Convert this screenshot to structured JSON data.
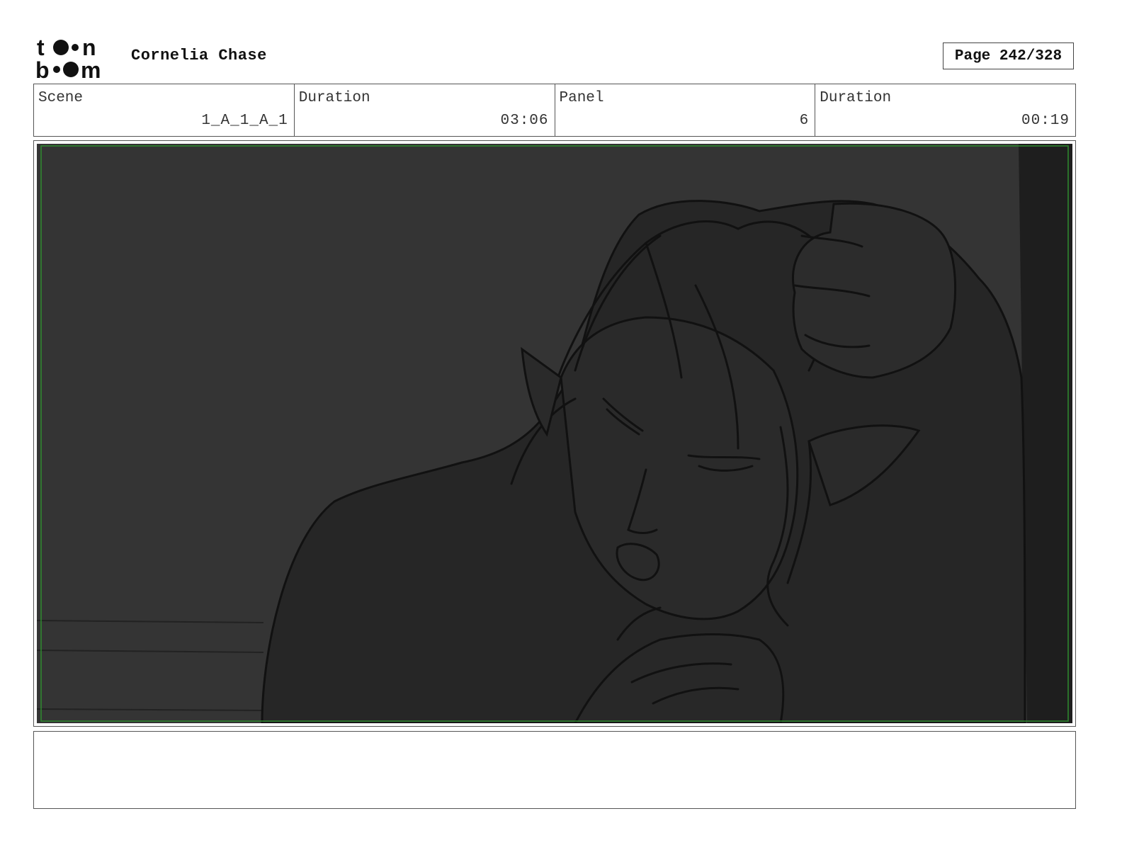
{
  "header": {
    "logo_text": "toon boom",
    "project_title": "Cornelia Chase",
    "page_label": "Page 242/328"
  },
  "info": {
    "scene_label": "Scene",
    "scene_value": "1_A_1_A_1",
    "scene_duration_label": "Duration",
    "scene_duration_value": "03:06",
    "panel_label": "Panel",
    "panel_value": "6",
    "panel_duration_label": "Duration",
    "panel_duration_value": "00:19"
  },
  "panel": {
    "safe_area_color": "#2e8b2e",
    "background_color": "#333333",
    "figure_color": "#262626"
  },
  "notes": {
    "text": ""
  }
}
